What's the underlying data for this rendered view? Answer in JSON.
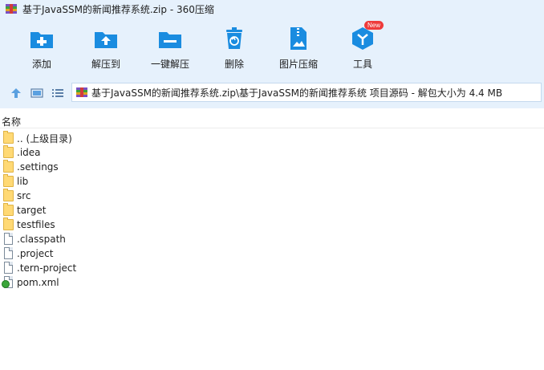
{
  "window": {
    "title": "基于JavaSSM的新闻推荐系统.zip - 360压缩"
  },
  "toolbar": {
    "items": [
      {
        "label": "添加",
        "icon": "add-icon"
      },
      {
        "label": "解压到",
        "icon": "extract-to-icon"
      },
      {
        "label": "一键解压",
        "icon": "one-click-extract-icon"
      },
      {
        "label": "删除",
        "icon": "delete-icon"
      },
      {
        "label": "图片压缩",
        "icon": "image-compress-icon"
      },
      {
        "label": "工具",
        "icon": "tools-icon",
        "badge": "New"
      }
    ]
  },
  "nav": {
    "path": "基于JavaSSM的新闻推荐系统.zip\\基于JavaSSM的新闻推荐系统 项目源码 - 解包大小为 4.4 MB"
  },
  "list": {
    "column_name": "名称",
    "files": [
      {
        "name": ".. (上级目录)",
        "type": "folder"
      },
      {
        "name": ".idea",
        "type": "folder"
      },
      {
        "name": ".settings",
        "type": "folder"
      },
      {
        "name": "lib",
        "type": "folder"
      },
      {
        "name": "src",
        "type": "folder"
      },
      {
        "name": "target",
        "type": "folder"
      },
      {
        "name": "testfiles",
        "type": "folder"
      },
      {
        "name": ".classpath",
        "type": "file"
      },
      {
        "name": ".project",
        "type": "file"
      },
      {
        "name": ".tern-project",
        "type": "file"
      },
      {
        "name": "pom.xml",
        "type": "xml"
      }
    ]
  },
  "colors": {
    "toolbar_bg": "#e6f1fc",
    "icon_blue": "#1a8ce0",
    "badge_red": "#ee3b3b"
  }
}
